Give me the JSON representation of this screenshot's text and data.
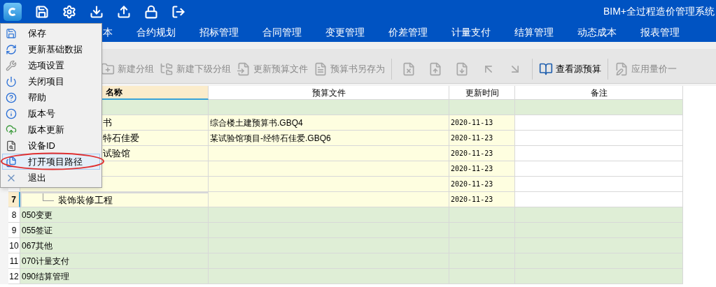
{
  "window": {
    "title": "BIM+全过程造价管理系统"
  },
  "nav": [
    {
      "label": "本",
      "selected": false
    },
    {
      "label": "合约规划",
      "selected": false
    },
    {
      "label": "招标管理",
      "selected": false
    },
    {
      "label": "合同管理",
      "selected": false
    },
    {
      "label": "变更管理",
      "selected": false
    },
    {
      "label": "价差管理",
      "selected": false
    },
    {
      "label": "计量支付",
      "selected": false
    },
    {
      "label": "结算管理",
      "selected": false
    },
    {
      "label": "动态成本",
      "selected": false
    },
    {
      "label": "报表管理",
      "selected": false
    }
  ],
  "toolbar": [
    {
      "label": "新建分组",
      "disabled": true
    },
    {
      "label": "新建下级分组",
      "disabled": true
    },
    {
      "label": "更新预算文件",
      "disabled": true
    },
    {
      "label": "预算书另存为",
      "disabled": true
    },
    {
      "disabled": true
    },
    {
      "disabled": true
    },
    {
      "disabled": true
    },
    {
      "disabled": true
    },
    {
      "disabled": true
    },
    {
      "label": "查看源预算",
      "disabled": false
    },
    {
      "label": "应用量价一",
      "disabled": true
    }
  ],
  "menu": [
    {
      "label": "保存",
      "selected": false
    },
    {
      "label": "更新基础数据",
      "selected": false
    },
    {
      "label": "选项设置",
      "selected": false
    },
    {
      "label": "关闭项目",
      "selected": false
    },
    {
      "label": "帮助",
      "selected": false
    },
    {
      "label": "版本号",
      "selected": false
    },
    {
      "label": "版本更新",
      "selected": false
    },
    {
      "label": "设备ID",
      "selected": false
    },
    {
      "label": "打开项目路径",
      "selected": true
    },
    {
      "label": "退出",
      "selected": false
    }
  ],
  "table": {
    "columns": [
      "名称",
      "预算文件",
      "更新时间",
      "备注"
    ],
    "rows": [
      {
        "kind": "group",
        "selected": false,
        "children": [
          {
            "kind": "item",
            "name": "书",
            "file": "综合楼土建预算书.GBQ4",
            "time": "2020-11-13",
            "selected": false
          },
          {
            "kind": "item",
            "name": "特石佳爱",
            "file": "某试验馆项目-经特石佳爱.GBQ6",
            "time": "2020-11-23",
            "selected": false
          },
          {
            "kind": "item",
            "name": "试验馆",
            "time": "2020-11-23",
            "selected": false,
            "children": [
              {
                "kind": "item",
                "time": "2020-11-23",
                "selected": false
              },
              {
                "kind": "item",
                "time": "2020-11-23",
                "selected": false
              },
              {
                "kind": "item",
                "num": "7",
                "name": "装饰装修工程",
                "time": "2020-11-23",
                "selected": true
              }
            ]
          }
        ]
      },
      {
        "kind": "group",
        "num": "8",
        "name": "050变更",
        "selected": false
      },
      {
        "kind": "group",
        "num": "9",
        "name": "055签证",
        "selected": false
      },
      {
        "kind": "group",
        "num": "10",
        "name": "067其他",
        "selected": false
      },
      {
        "kind": "group",
        "num": "11",
        "name": "070计量支付",
        "selected": false
      },
      {
        "kind": "group",
        "num": "12",
        "name": "090结算管理",
        "selected": false
      }
    ]
  }
}
